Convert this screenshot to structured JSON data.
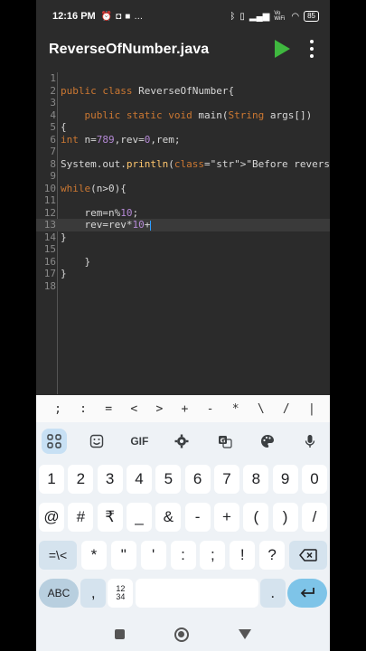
{
  "status_bar": {
    "time": "12:16 PM",
    "left_icons": [
      "alarm-icon",
      "camera-icon",
      "video-icon"
    ],
    "more": "…",
    "network": "Vo WiFi",
    "battery": "85"
  },
  "app_bar": {
    "title": "ReverseOfNumber.java",
    "run_icon": "play-icon",
    "menu_icon": "overflow-menu-icon",
    "accent_color": "#3fb83f"
  },
  "editor": {
    "active_line": 12,
    "lines": [
      {
        "n": "1",
        "text": ""
      },
      {
        "n": "2",
        "text": "public class ReverseOfNumber{"
      },
      {
        "n": "3",
        "text": ""
      },
      {
        "n": "4",
        "text": "    public static void main(String args[])"
      },
      {
        "n": "5",
        "text": "{"
      },
      {
        "n": "6",
        "text": "int n=789,rev=0,rem;"
      },
      {
        "n": "7",
        "text": ""
      },
      {
        "n": "8",
        "text": "System.out.println(\"Before reverse : \"+n);"
      },
      {
        "n": "9",
        "text": ""
      },
      {
        "n": "10",
        "text": "while(n>0){"
      },
      {
        "n": "11",
        "text": ""
      },
      {
        "n": "12",
        "text": "    rem=n%10;"
      },
      {
        "n": "13",
        "text": "    rev=rev*10+"
      },
      {
        "n": "14",
        "text": "}"
      },
      {
        "n": "15",
        "text": ""
      },
      {
        "n": "16",
        "text": "    }"
      },
      {
        "n": "17",
        "text": "}"
      },
      {
        "n": "18",
        "text": ""
      }
    ]
  },
  "symbol_row": [
    ";",
    ":",
    "=",
    "<",
    ">",
    "+",
    "-",
    "*",
    "\\",
    "/",
    "|"
  ],
  "keyboard": {
    "toolbar": [
      "apps-icon",
      "sticker-icon",
      "GIF",
      "settings-icon",
      "translate-icon",
      "palette-icon",
      "mic-icon"
    ],
    "gif_label": "GIF",
    "row_numbers": [
      "1",
      "2",
      "3",
      "4",
      "5",
      "6",
      "7",
      "8",
      "9",
      "0"
    ],
    "row_symbols": [
      "@",
      "#",
      "₹",
      "_",
      "&",
      "-",
      "+",
      "(",
      ")",
      "/"
    ],
    "row_more": [
      "=\\<",
      "*",
      "\"",
      "'",
      ":",
      ";",
      "!",
      "?"
    ],
    "backspace_icon": "backspace-icon",
    "abc_label": "ABC",
    "comma": ",",
    "num_switch": "12\n34",
    "period": ".",
    "enter_icon": "enter-icon"
  },
  "nav": [
    "recent-apps-icon",
    "home-icon",
    "back-icon"
  ]
}
